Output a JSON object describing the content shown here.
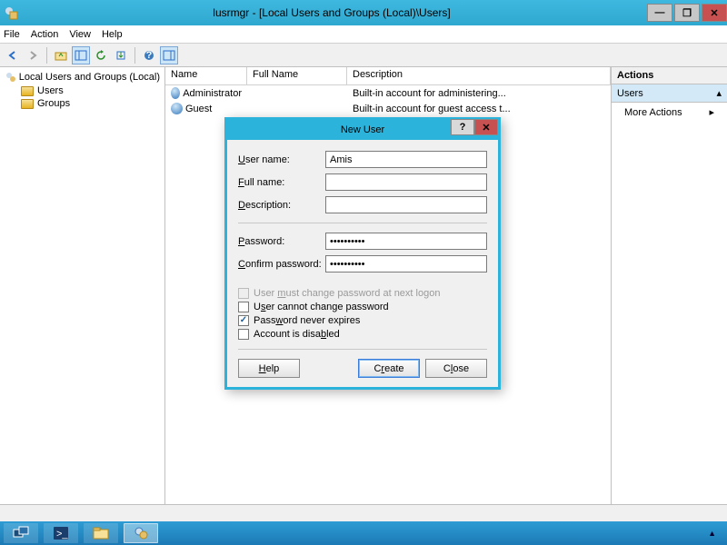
{
  "window": {
    "title": "lusrmgr - [Local Users and Groups (Local)\\Users]",
    "controls": {
      "min": "—",
      "max": "❐",
      "close": "✕"
    }
  },
  "menu": {
    "file": "File",
    "action": "Action",
    "view": "View",
    "help": "Help"
  },
  "tree": {
    "root": "Local Users and Groups (Local)",
    "users": "Users",
    "groups": "Groups"
  },
  "list": {
    "headers": {
      "name": "Name",
      "full": "Full Name",
      "desc": "Description"
    },
    "rows": [
      {
        "name": "Administrator",
        "full": "",
        "desc": "Built-in account for administering..."
      },
      {
        "name": "Guest",
        "full": "",
        "desc": "Built-in account for guest access t..."
      }
    ]
  },
  "actions": {
    "title": "Actions",
    "section": "Users",
    "more": "More Actions"
  },
  "dialog": {
    "title": "New User",
    "help_glyph": "?",
    "close_glyph": "✕",
    "labels": {
      "username": "User name:",
      "fullname": "Full name:",
      "description": "Description:",
      "password": "Password:",
      "confirm": "Confirm password:"
    },
    "values": {
      "username": "Amis",
      "fullname": "",
      "description": "",
      "password": "••••••••••",
      "confirm": "••••••••••"
    },
    "checks": {
      "must_change": "User must change password at next logon",
      "cannot_change": "User cannot change password",
      "never_expires": "Password never expires",
      "disabled": "Account is disabled"
    },
    "buttons": {
      "help": "Help",
      "create": "Create",
      "close": "Close"
    },
    "underlines": {
      "help": "H",
      "create": "r",
      "close": "l",
      "must": "m",
      "cannot": "s",
      "never": "w",
      "disabled": "b",
      "username": "U",
      "fullname": "F",
      "description": "D",
      "password": "P",
      "confirm": "C"
    }
  }
}
